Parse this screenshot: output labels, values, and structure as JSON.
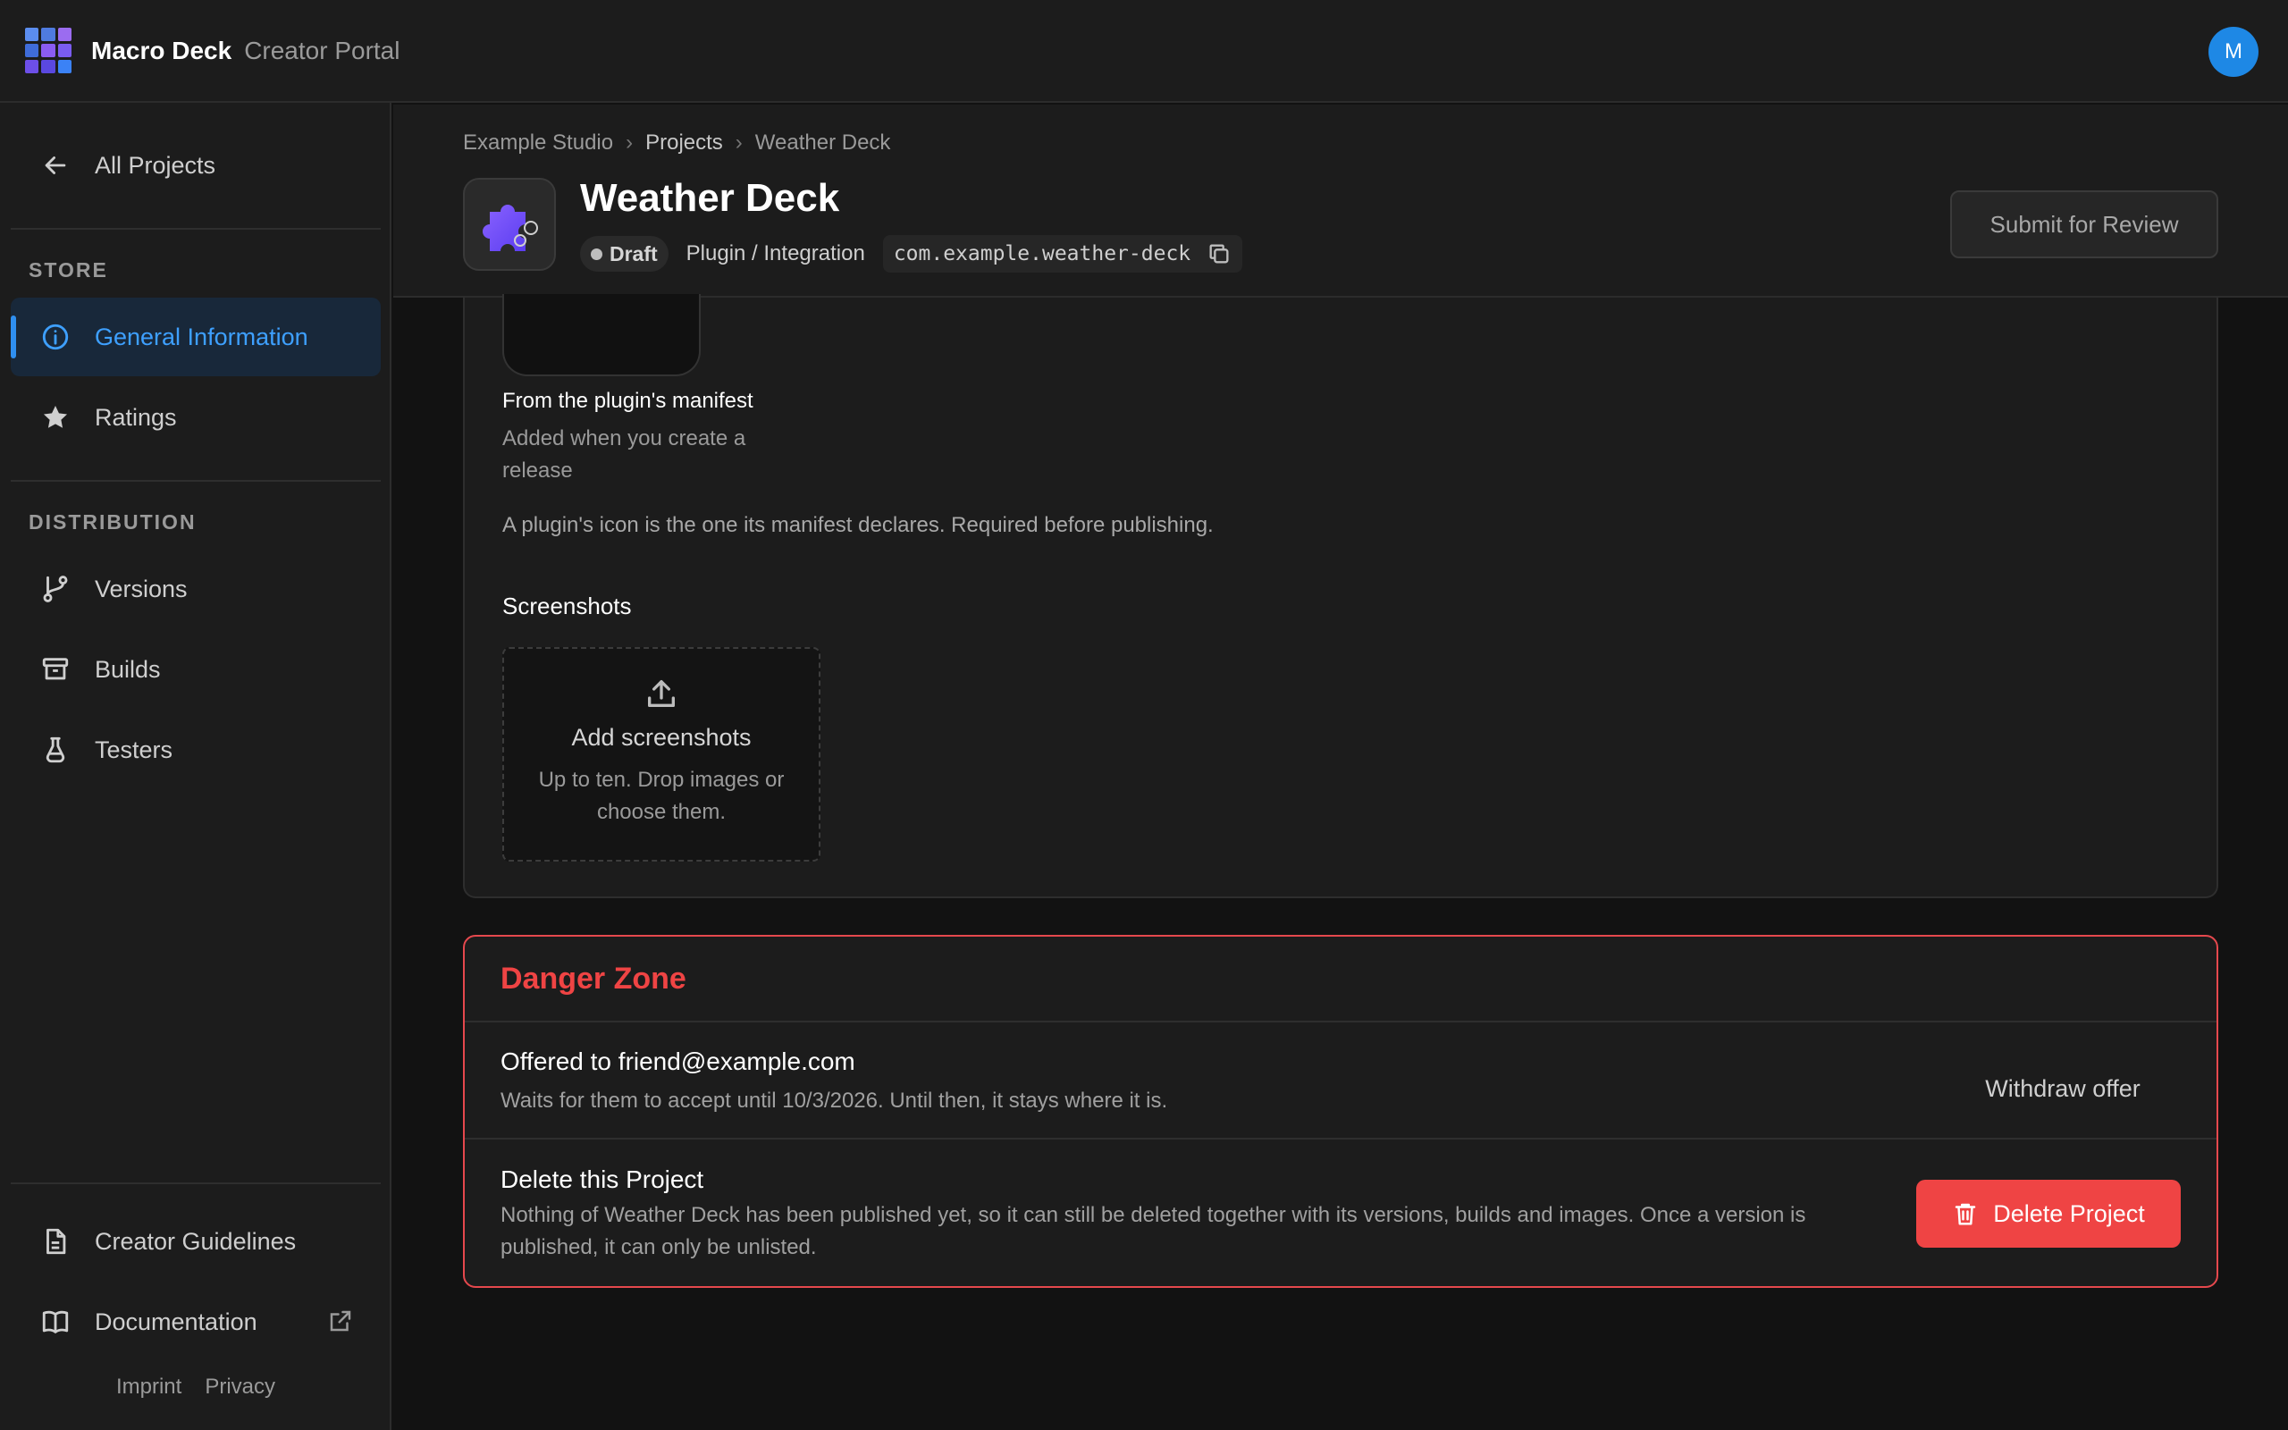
{
  "app": {
    "name": "Macro Deck",
    "subtitle": "Creator Portal",
    "avatar_initial": "M"
  },
  "sidebar": {
    "back_label": "All Projects",
    "store_label": "STORE",
    "store_items": [
      {
        "label": "General Information",
        "icon": "info-icon",
        "active": true
      },
      {
        "label": "Ratings",
        "icon": "star-icon",
        "active": false
      }
    ],
    "distribution_label": "DISTRIBUTION",
    "distribution_items": [
      {
        "label": "Versions",
        "icon": "branch-icon"
      },
      {
        "label": "Builds",
        "icon": "archive-icon"
      },
      {
        "label": "Testers",
        "icon": "flask-icon"
      }
    ],
    "bottom_items": [
      {
        "label": "Creator Guidelines",
        "icon": "document-icon"
      },
      {
        "label": "Documentation",
        "icon": "book-icon",
        "external": true
      }
    ],
    "footer": {
      "imprint": "Imprint",
      "privacy": "Privacy"
    }
  },
  "header": {
    "breadcrumb": [
      "Example Studio",
      "Projects",
      "Weather Deck"
    ],
    "title": "Weather Deck",
    "status": "Draft",
    "category": "Plugin / Integration",
    "bundle_id": "com.example.weather-deck",
    "submit_label": "Submit for Review"
  },
  "icon_section": {
    "manifest_title": "From the plugin's manifest",
    "manifest_sub": "Added when you create a release",
    "note": "A plugin's icon is the one its manifest declares. Required before publishing."
  },
  "screenshots": {
    "label": "Screenshots",
    "add_title": "Add screenshots",
    "add_sub": "Up to ten. Drop images or choose them."
  },
  "danger": {
    "title": "Danger Zone",
    "offer_title": "Offered to friend@example.com",
    "offer_sub": "Waits for them to accept until 10/3/2026. Until then, it stays where it is.",
    "withdraw_label": "Withdraw offer",
    "delete_title": "Delete this Project",
    "delete_sub": "Nothing of Weather Deck has been published yet, so it can still be deleted together with its versions, builds and images. Once a version is published, it can only be unlisted.",
    "delete_label": "Delete Project"
  },
  "colors": {
    "accent": "#3ea0ff",
    "danger": "#ef4444",
    "avatar": "#1e88e5",
    "background": "#121212",
    "surface": "#1c1c1c"
  }
}
